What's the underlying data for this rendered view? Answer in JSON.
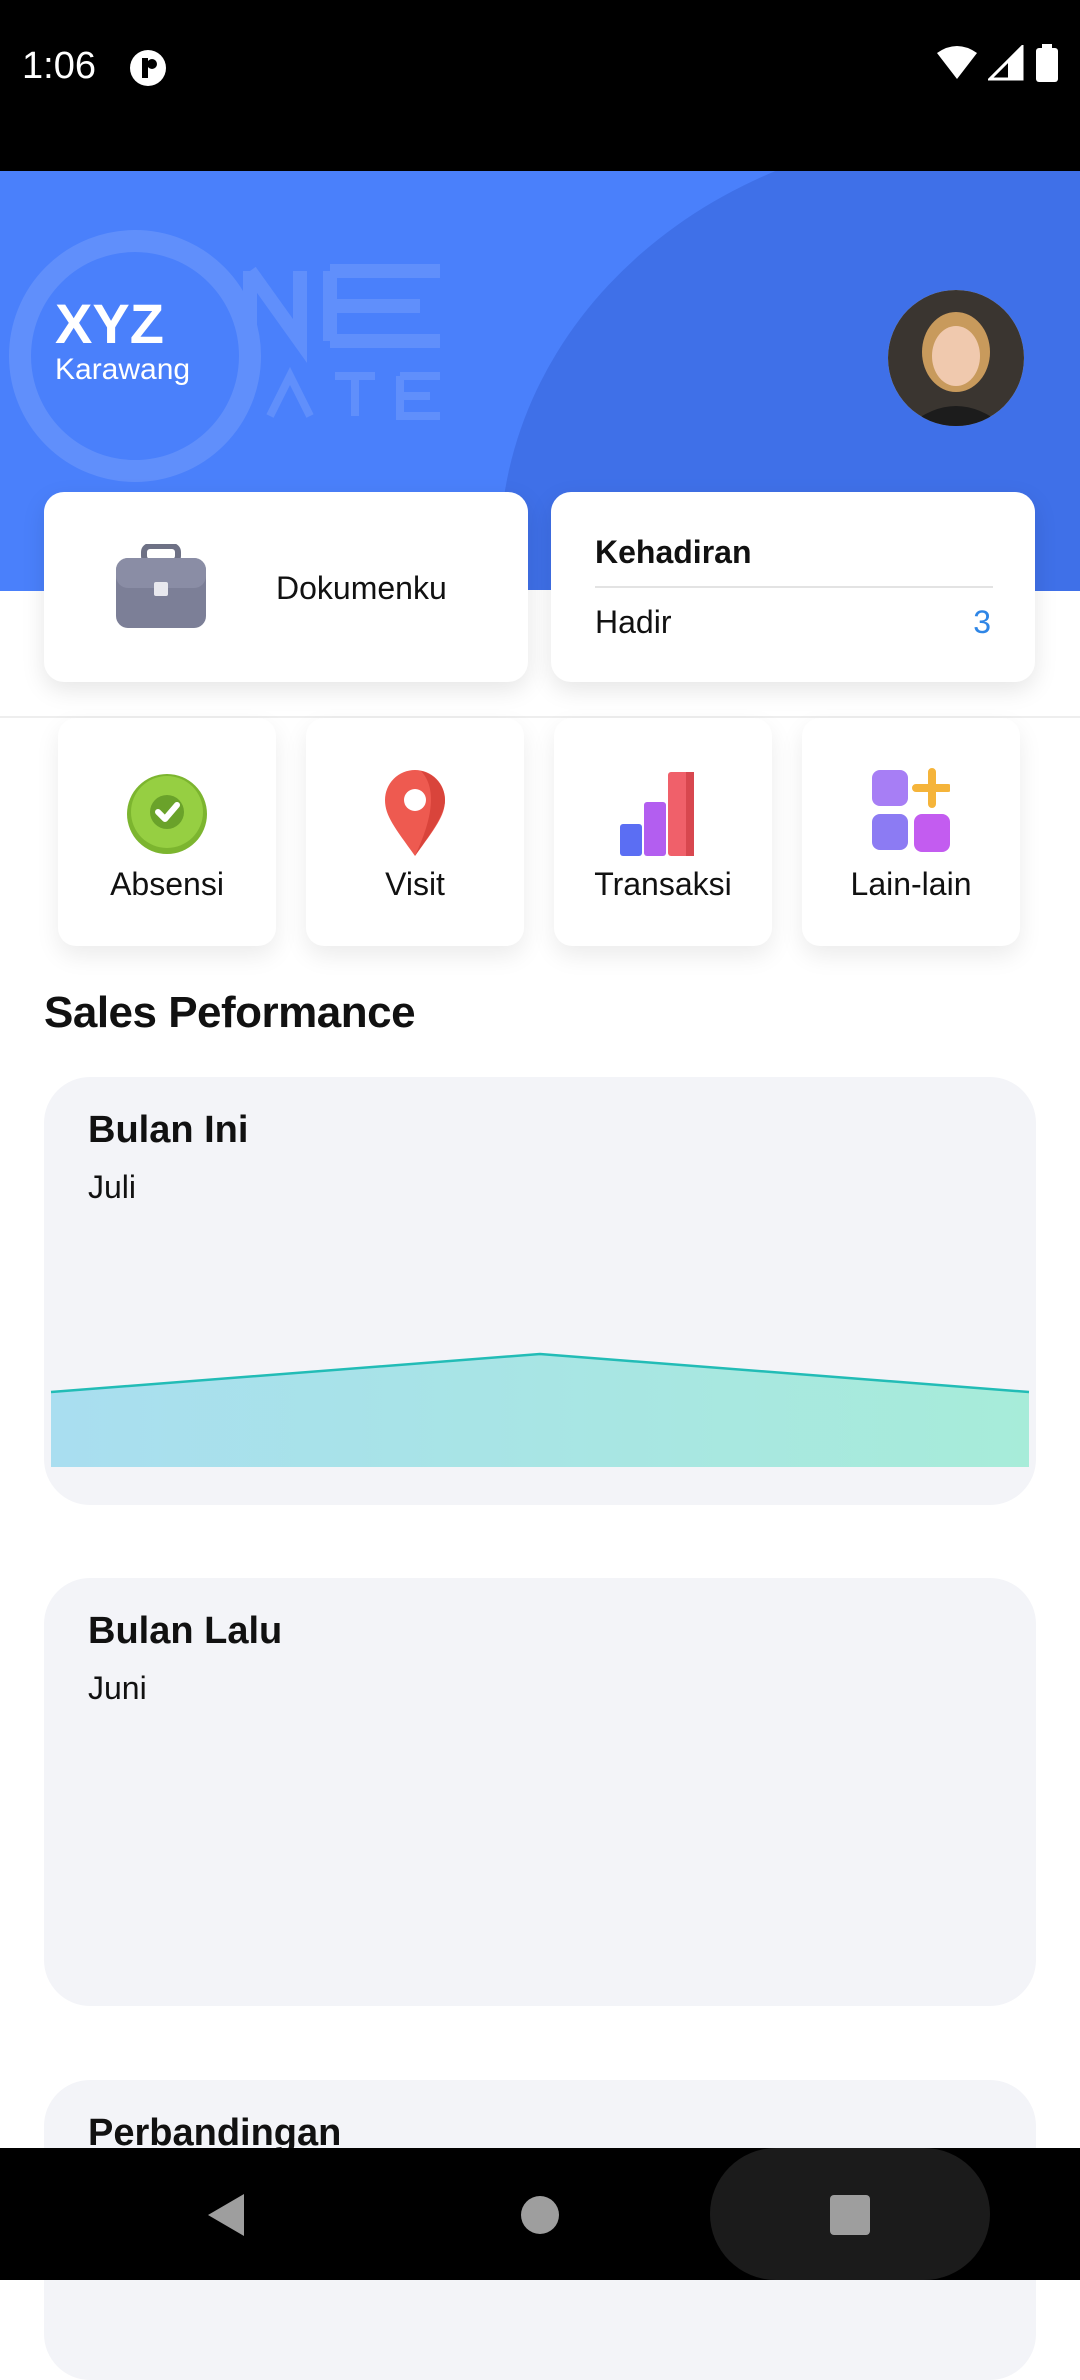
{
  "status_bar": {
    "time": "1:06",
    "icons": [
      "notification-icon",
      "wifi-icon",
      "signal-icon",
      "battery-icon"
    ]
  },
  "header": {
    "user_name": "XYZ",
    "location": "Karawang",
    "background_color": "#4a80fb"
  },
  "cards": {
    "documents": {
      "label": "Dokumenku",
      "icon": "briefcase-icon"
    },
    "attendance": {
      "title": "Kehadiran",
      "row_label": "Hadir",
      "row_value": "3"
    }
  },
  "menu": [
    {
      "label": "Absensi",
      "icon": "check-circle-icon"
    },
    {
      "label": "Visit",
      "icon": "location-pin-icon"
    },
    {
      "label": "Transaksi",
      "icon": "bar-chart-icon"
    },
    {
      "label": "Lain-lain",
      "icon": "apps-plus-icon"
    }
  ],
  "sales": {
    "section_title": "Sales Peformance",
    "this_month": {
      "title": "Bulan Ini",
      "month": "Juli"
    },
    "last_month": {
      "title": "Bulan Lalu",
      "month": "Juni"
    },
    "comparison": {
      "title": "Perbandingan"
    }
  },
  "chart_data": {
    "type": "area",
    "title": "Bulan Ini",
    "subtitle": "Juli",
    "x": [
      0,
      1,
      2
    ],
    "series": [
      {
        "values": [
          1,
          2,
          1
        ]
      }
    ],
    "ylim": [
      0,
      2
    ],
    "grid": false,
    "line_color": "#22bcb6",
    "fill_colors": [
      "#a9def0",
      "#a7ecd9"
    ]
  },
  "nav_bar": {
    "items": [
      "back-icon",
      "home-icon",
      "recents-icon"
    ]
  }
}
